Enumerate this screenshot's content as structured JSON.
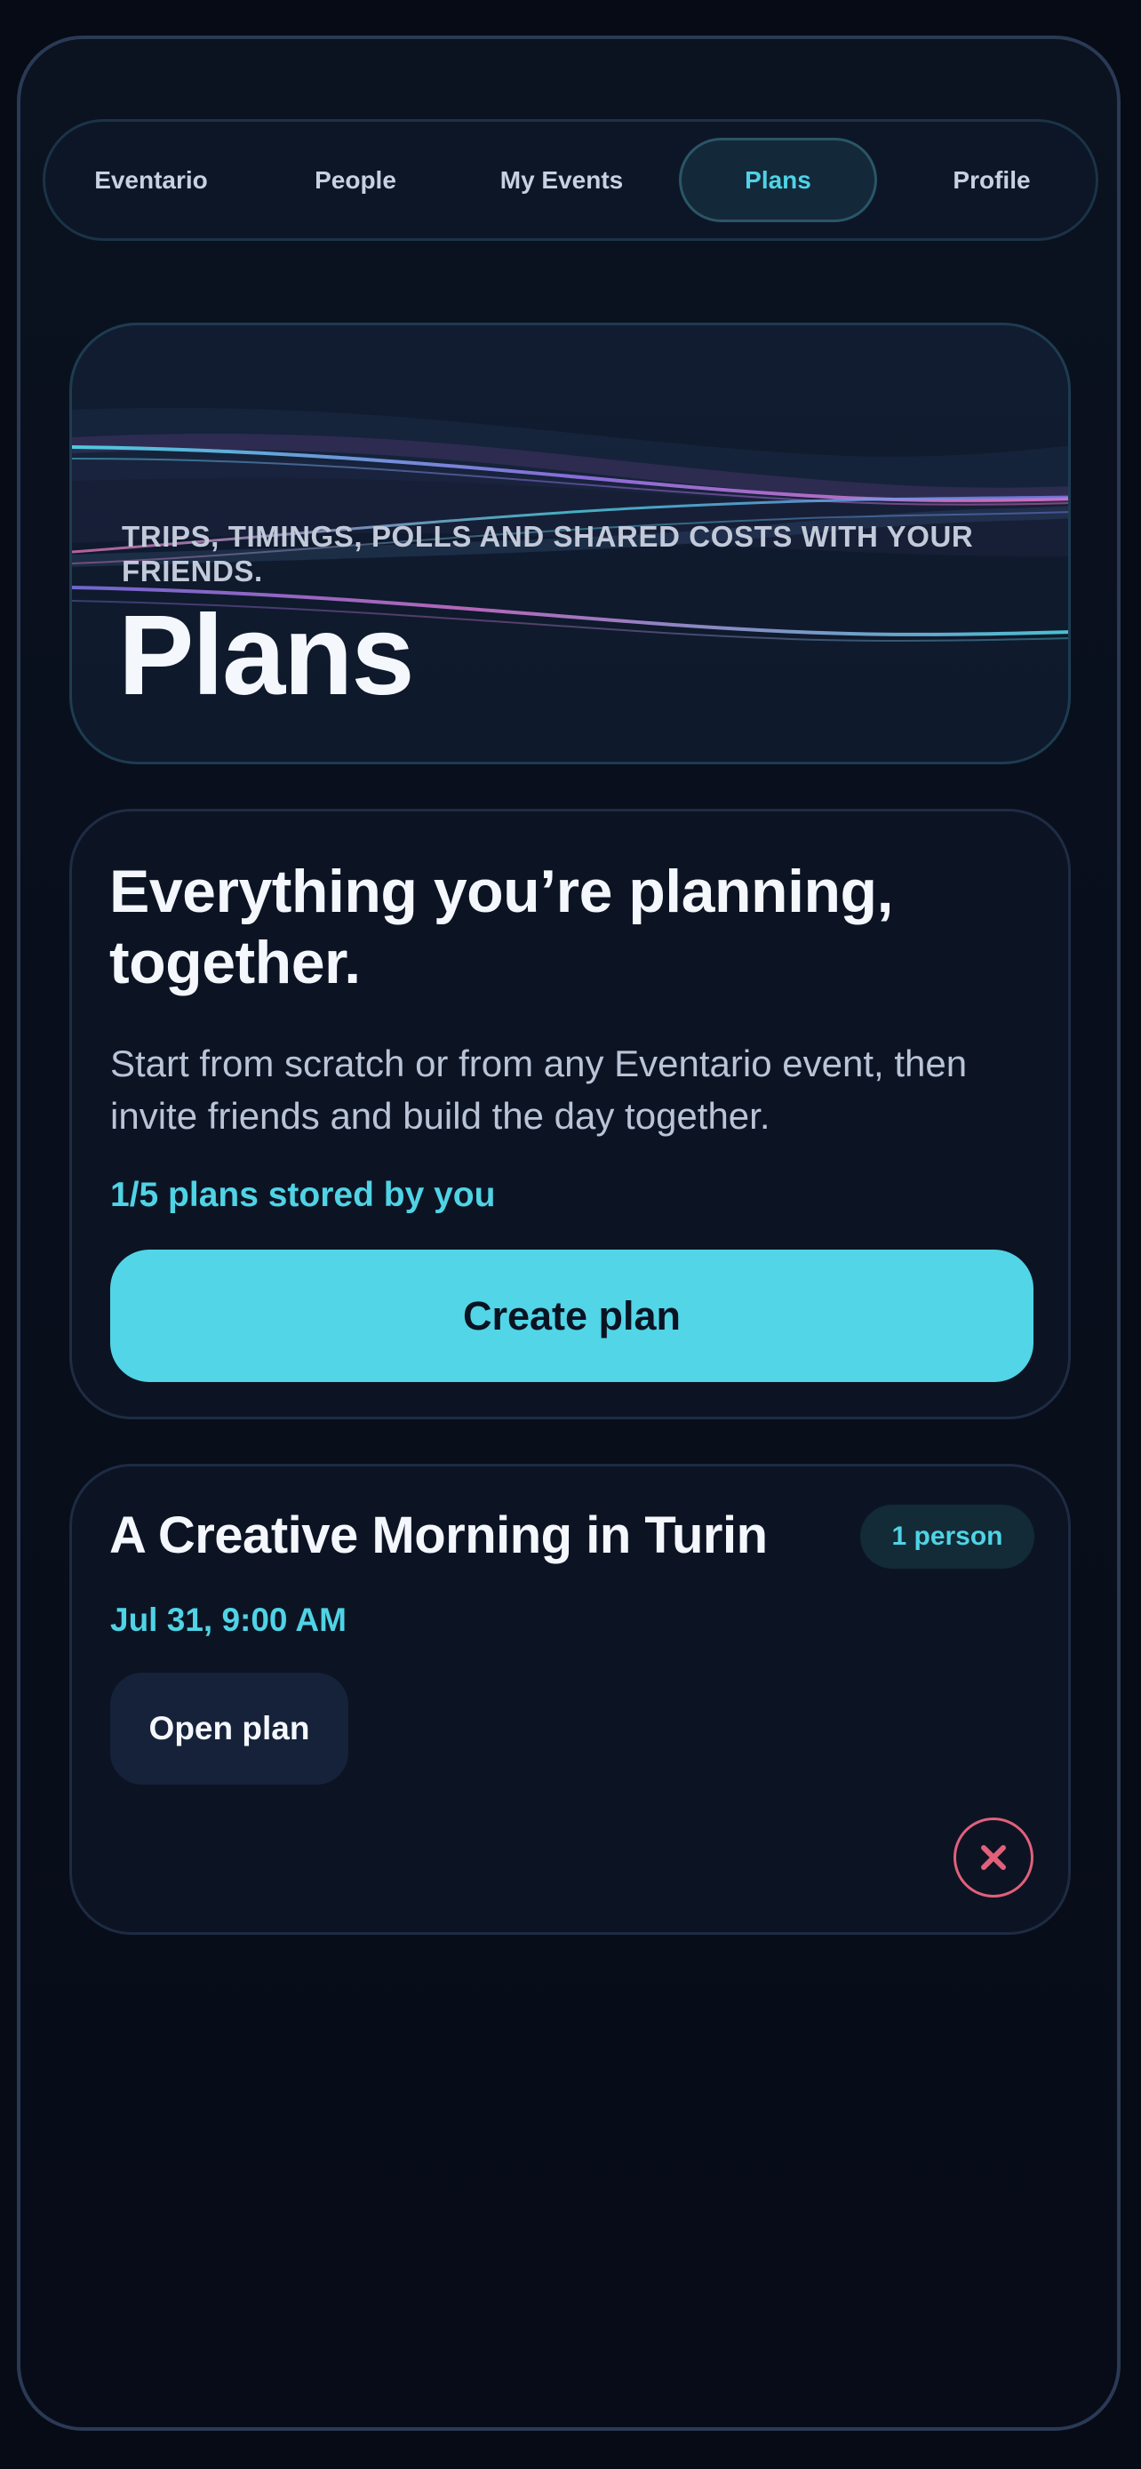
{
  "nav": {
    "tabs": [
      {
        "label": "Eventario",
        "active": false
      },
      {
        "label": "People",
        "active": false
      },
      {
        "label": "My Events",
        "active": false
      },
      {
        "label": "Plans",
        "active": true
      },
      {
        "label": "Profile",
        "active": false
      }
    ]
  },
  "hero": {
    "subtitle": "Trips, timings, polls and shared costs with your friends.",
    "title": "Plans"
  },
  "intro": {
    "heading": "Everything you’re planning, together.",
    "description": "Start from scratch or from any Eventario event, then invite friends and build the day together.",
    "storage_count": "1/5 plans stored by you",
    "create_button_label": "Create plan"
  },
  "plans": [
    {
      "title": "A Creative Morning in Turin",
      "attendees_badge": "1 person",
      "datetime": "Jul 31, 9:00 AM",
      "open_button_label": "Open plan",
      "delete_icon": "close-icon"
    }
  ],
  "colors": {
    "accent": "#52d5e6",
    "background": "#060b16",
    "card": "#0c1424",
    "danger": "#e2607a",
    "text": "#f4f7fc",
    "muted_text": "#b9c4d6"
  }
}
